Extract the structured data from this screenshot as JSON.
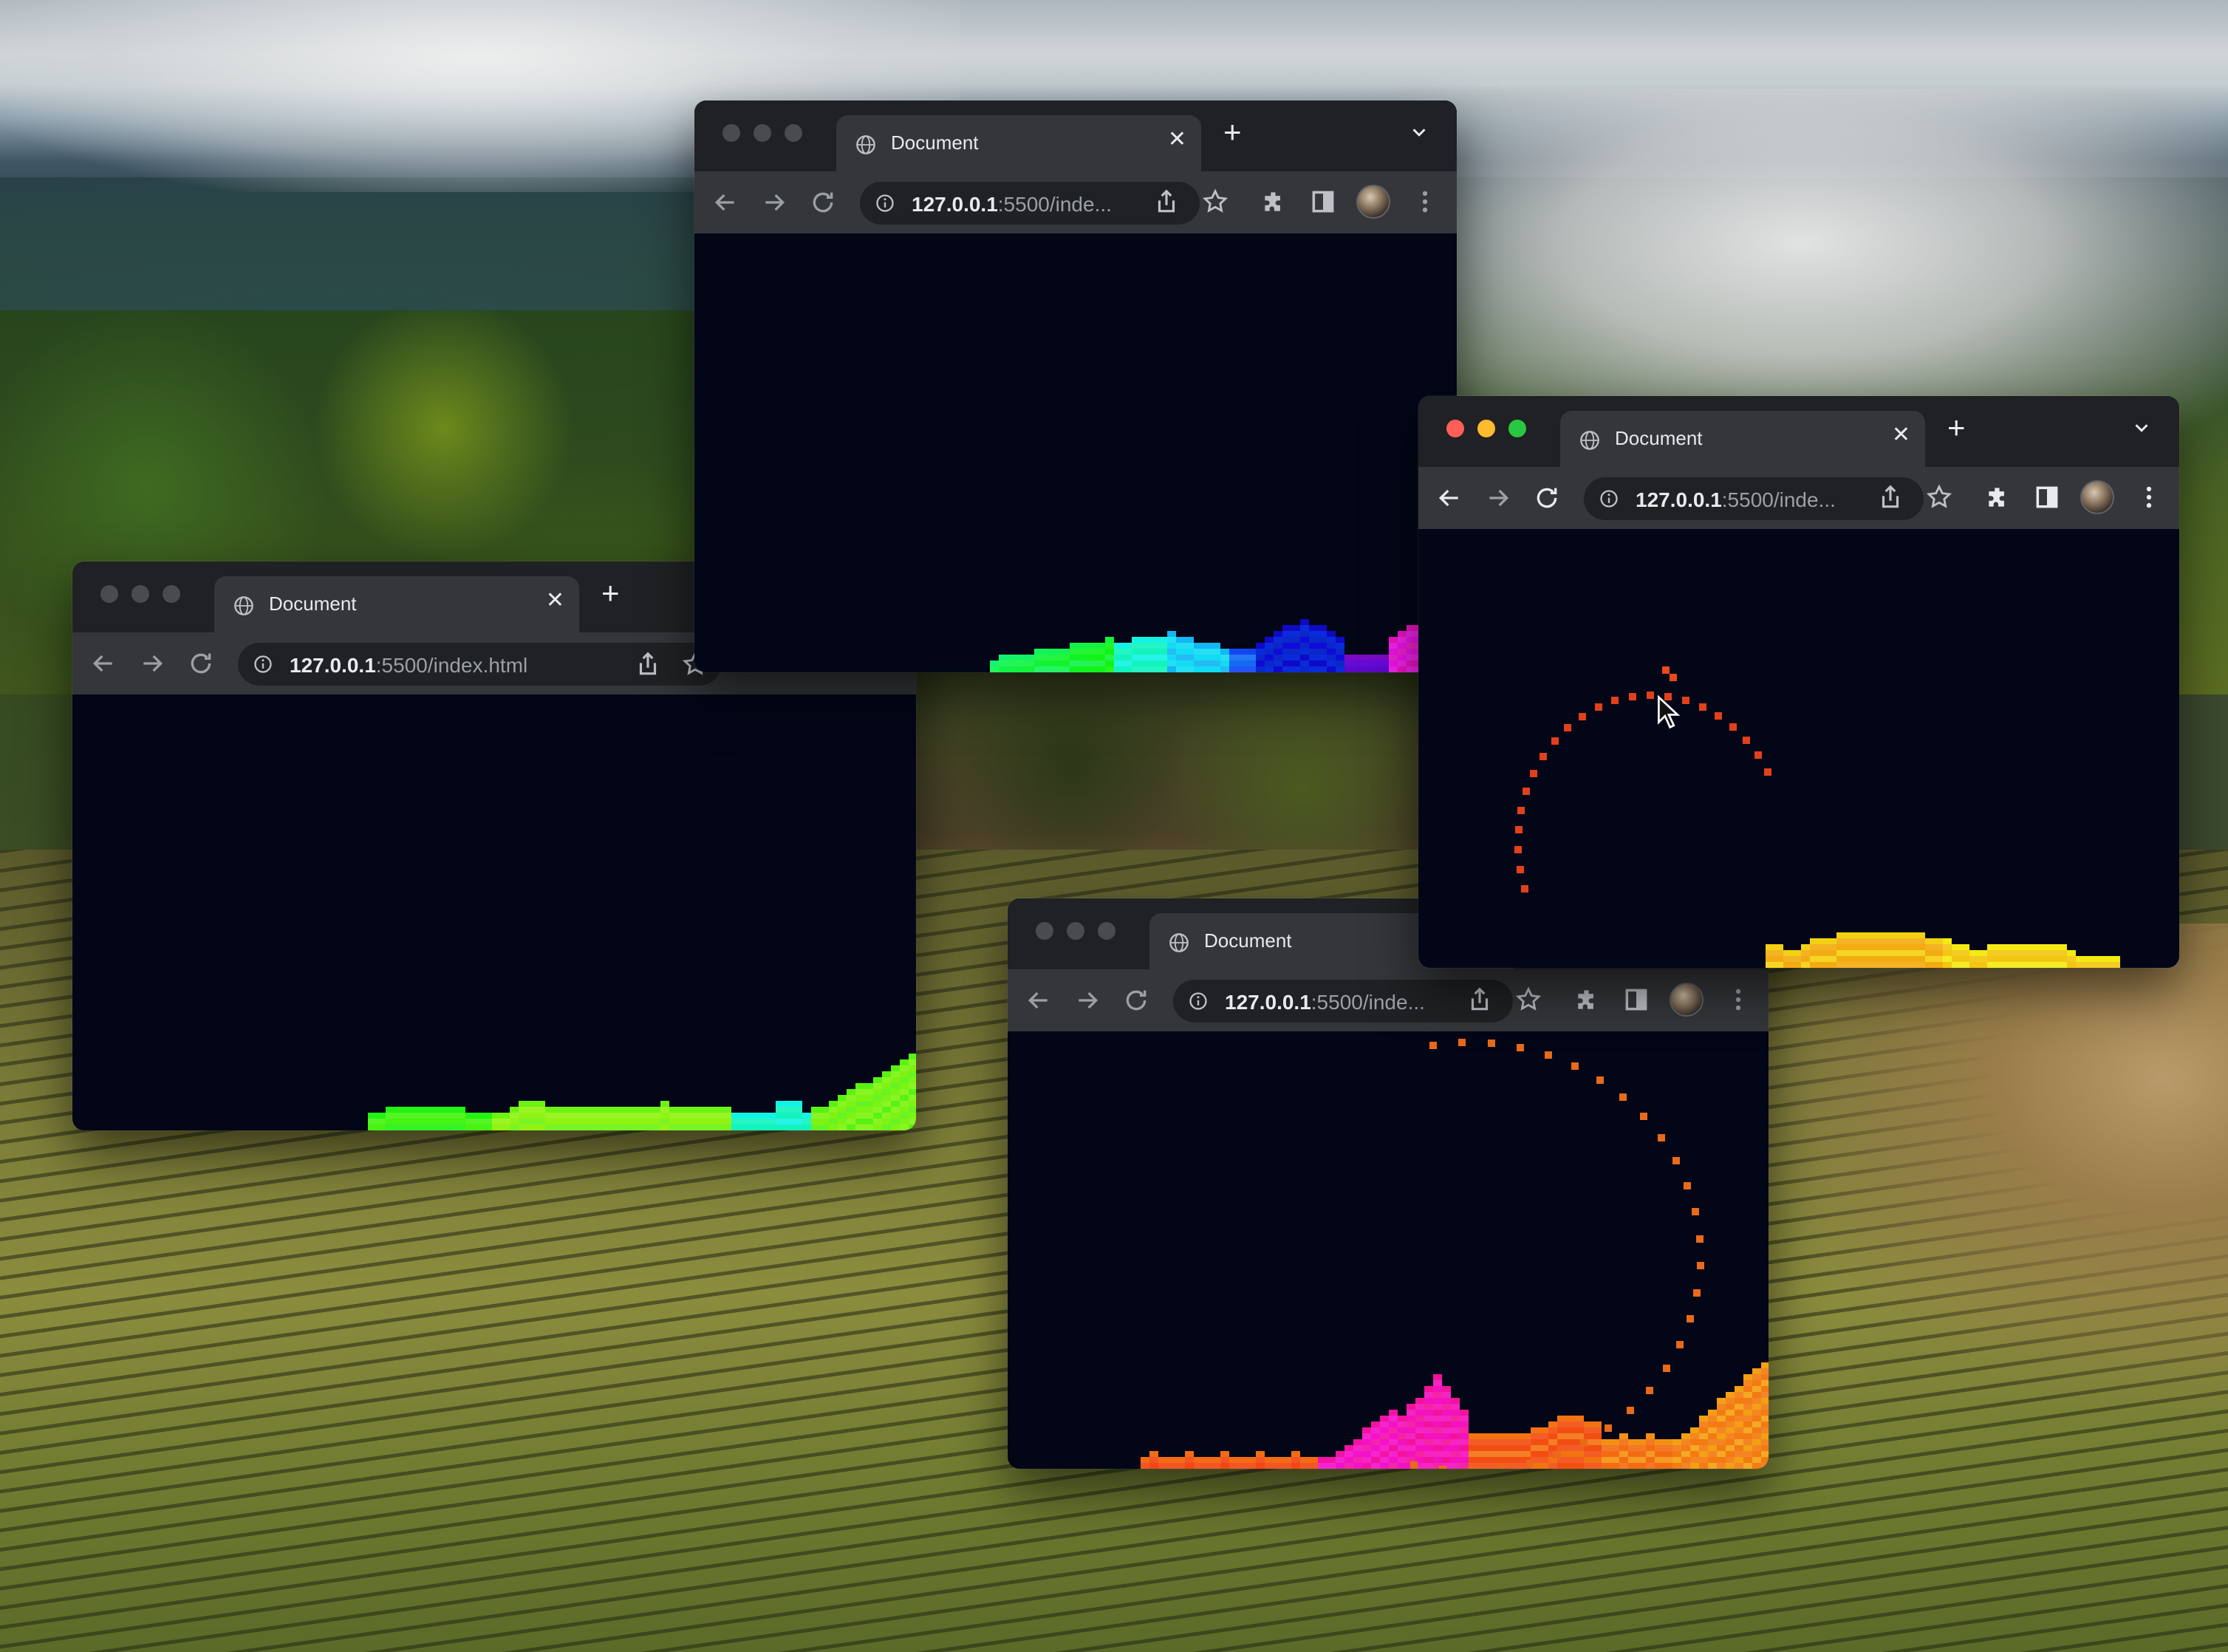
{
  "desktop": {
    "wallpaper": "vineyard-hills"
  },
  "windows": [
    {
      "id": "top",
      "active": false,
      "tab_title": "Document",
      "url_host": "127.0.0.1",
      "url_rest": ":5500/inde...",
      "art": "blue-green-magenta-dunes"
    },
    {
      "id": "right",
      "active": true,
      "tab_title": "Document",
      "url_host": "127.0.0.1",
      "url_rest": ":5500/inde...",
      "art": "orange-yellow-dunes-with-red-dotted-arc"
    },
    {
      "id": "left",
      "active": false,
      "tab_title": "Document",
      "url_host": "127.0.0.1",
      "url_rest": ":5500/index.html",
      "art": "green-dunes"
    },
    {
      "id": "bottom",
      "active": false,
      "tab_title": "Document",
      "url_host": "127.0.0.1",
      "url_rest": ":5500/inde...",
      "art": "magenta-orange-dunes-with-orange-dotted-arc"
    }
  ],
  "icons": [
    "globe-icon",
    "close-icon",
    "new-tab-icon",
    "tab-search-icon",
    "back-icon",
    "forward-icon",
    "reload-icon",
    "info-icon",
    "share-icon",
    "bookmark-star-icon",
    "extensions-icon",
    "side-panel-icon",
    "more-icon",
    "pocket-icon",
    "cursor-icon"
  ]
}
